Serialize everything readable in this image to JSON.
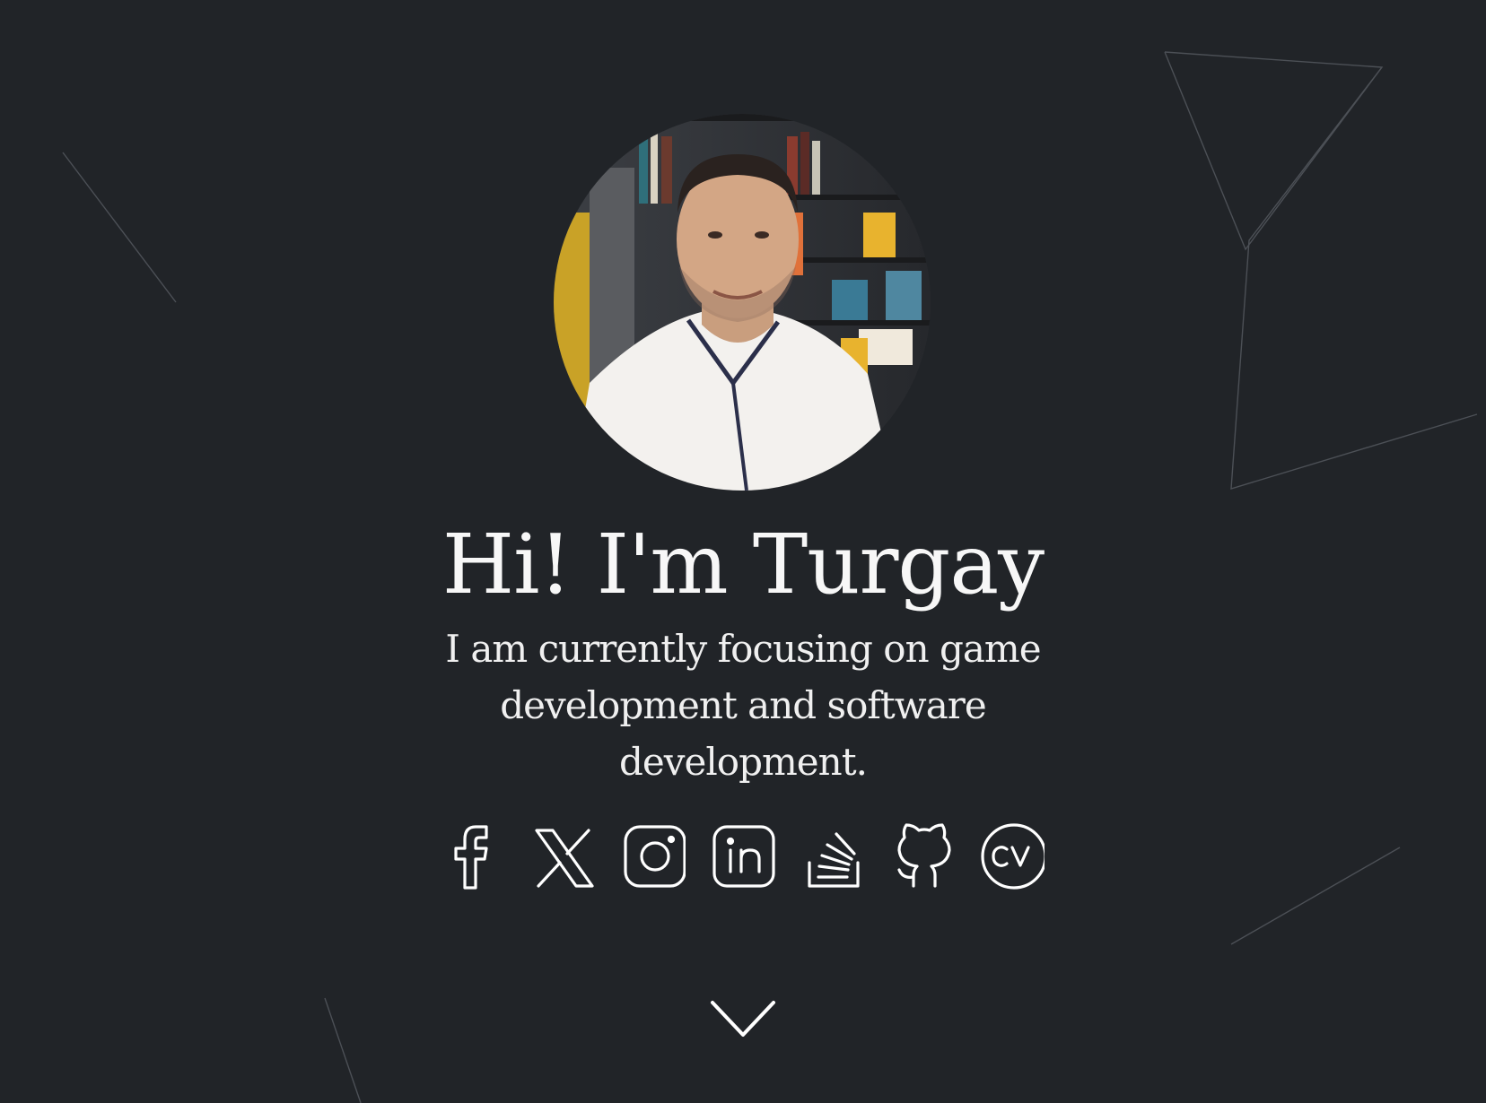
{
  "hero": {
    "title": "Hi! I'm Turgay",
    "subtitle": "I am currently focusing on game development and software development.",
    "avatar_alt": "profile-photo"
  },
  "social_links": [
    {
      "name": "facebook",
      "icon": "facebook-icon"
    },
    {
      "name": "x",
      "icon": "x-twitter-icon"
    },
    {
      "name": "instagram",
      "icon": "instagram-icon"
    },
    {
      "name": "linkedin",
      "icon": "linkedin-icon"
    },
    {
      "name": "stackoverflow",
      "icon": "stackoverflow-icon"
    },
    {
      "name": "github",
      "icon": "github-icon"
    },
    {
      "name": "cv",
      "icon": "cv-icon",
      "label": "CV"
    }
  ],
  "scroll_indicator": {
    "icon": "chevron-down-icon"
  },
  "colors": {
    "background": "#212428",
    "text": "#f4f4f4",
    "line": "#4a4d52"
  }
}
